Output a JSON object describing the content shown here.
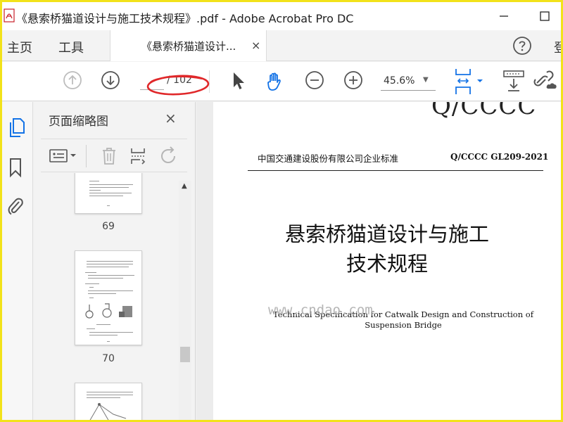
{
  "window": {
    "title": "《悬索桥猫道设计与施工技术规程》.pdf - Adobe Acrobat Pro DC",
    "minimize_glyph": "—",
    "maximize_glyph": "☐"
  },
  "tabbar": {
    "home": "主页",
    "tools": "工具",
    "doc_tab": "《悬索桥猫道设计...",
    "doc_tab_close": "×",
    "signin_partial": "登"
  },
  "toolbar": {
    "page_current": "",
    "page_total": "/ 102",
    "zoom": "45.6%",
    "annotation_color": "#e0282a"
  },
  "thumbnail_panel": {
    "title": "页面缩略图",
    "close": "×",
    "pages": [
      {
        "label": "69"
      },
      {
        "label": "70"
      },
      {
        "label": ""
      }
    ]
  },
  "document": {
    "top_code_partial": "Q/CCCC",
    "org_name": "中国交通建设股份有限公司企业标准",
    "standard_code": "Q/CCCC GL209-2021",
    "title_cn_line1": "悬索桥猫道设计与施工",
    "title_cn_line2": "技术规程",
    "title_en_line1": "Technical Specification for Catwalk Design and Construction of",
    "title_en_line2": "Suspension Bridge"
  },
  "watermark": "www.cndao.com",
  "colors": {
    "frame": "#f2e21a",
    "accent_blue": "#1473e6",
    "icon_gray": "#6b6b6b"
  }
}
